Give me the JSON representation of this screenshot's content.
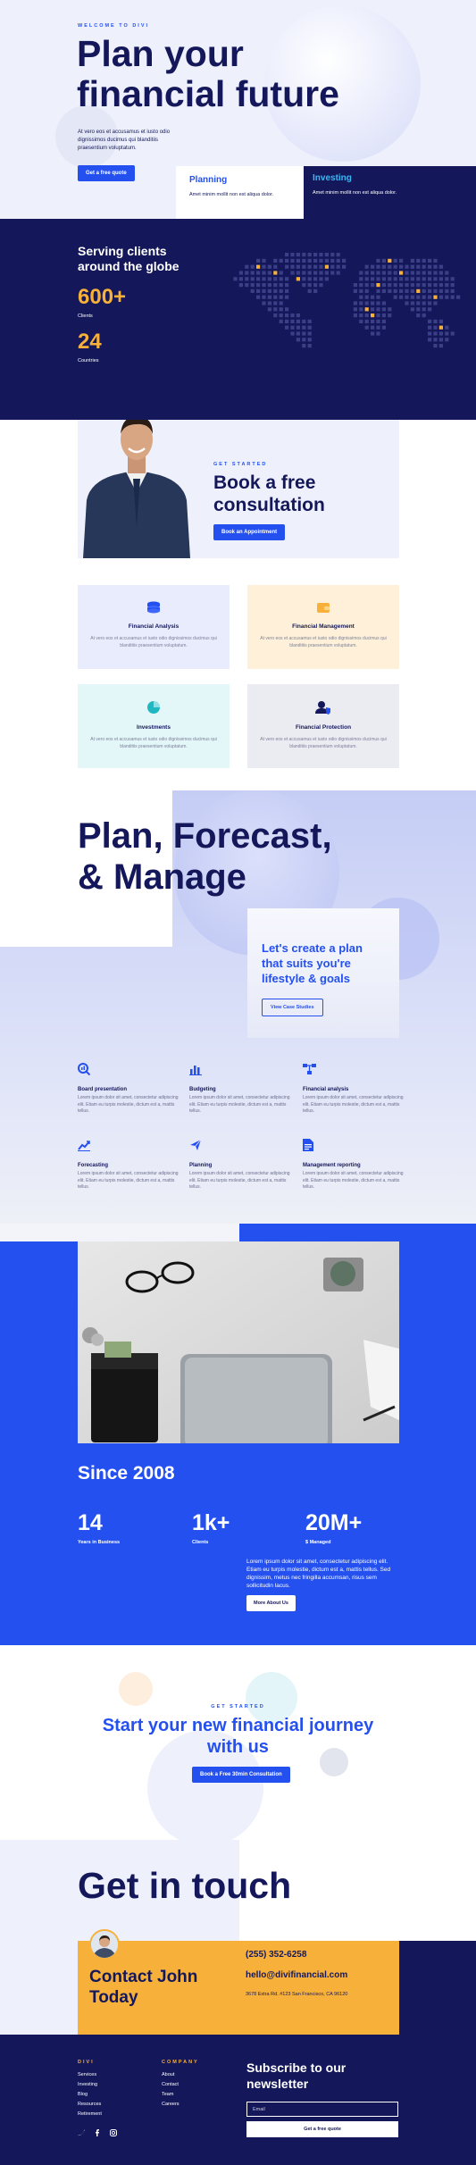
{
  "hero": {
    "eyebrow": "WELCOME TO DIVI",
    "title_line1": "Plan your",
    "title_line2": "financial future",
    "description": "At vero eos et accusamus et iusto odio dignissimos ducimus qui blanditiis praesentium voluptatum.",
    "cta_label": "Get a free quote",
    "cards": [
      {
        "title": "Planning",
        "text": "Amet minim mollit non est aliqua dolor."
      },
      {
        "title": "Investing",
        "text": "Amet minim mollit non est aliqua dolor."
      }
    ]
  },
  "world": {
    "heading_line1": "Serving clients",
    "heading_line2": "around the globe",
    "stats": [
      {
        "value": "600+",
        "label": "Clients"
      },
      {
        "value": "24",
        "label": "Countries"
      }
    ]
  },
  "consult": {
    "eyebrow": "GET STARTED",
    "title_line1": "Book a free",
    "title_line2": "consultation",
    "cta_label": "Book an Appointment"
  },
  "services": [
    {
      "title": "Financial Analysis",
      "text": "At vero eos et accusamus et iusto odio dignissimos ducimus qui blanditiis praesentium voluptatum.",
      "icon": "coins-stack-icon",
      "bg": "#e8ecfd",
      "color": "#2450f0"
    },
    {
      "title": "Financial Management",
      "text": "At vero eos et accusamus et iusto odio dignissimos ducimus qui blanditiis praesentium voluptatum.",
      "icon": "wallet-icon",
      "bg": "#fff1d9",
      "color": "#f7b13b"
    },
    {
      "title": "Investments",
      "text": "At vero eos et accusamus et iusto odio dignissimos ducimus qui blanditiis praesentium voluptatum.",
      "icon": "pie-chart-icon",
      "bg": "#e3f7f8",
      "color": "#1fb7c1"
    },
    {
      "title": "Financial Protection",
      "text": "At vero eos et accusamus et iusto odio dignissimos ducimus qui blanditiis praesentium voluptatum.",
      "icon": "user-shield-icon",
      "bg": "#ebebf2",
      "color": "#14185a"
    }
  ],
  "plan": {
    "title_line1": "Plan, Forecast,",
    "title_line2": "& Manage",
    "card_title": "Let's create a plan that suits you're lifestyle & goals",
    "card_cta": "View Case Studies",
    "features": [
      {
        "title": "Board presentation",
        "text": "Lorem ipsum dolor sit amet, consectetur adipiscing elit. Etiam eu turpis molestie, dictum est a, mattis tellus.",
        "icon": "search-chart-icon"
      },
      {
        "title": "Budgeting",
        "text": "Lorem ipsum dolor sit amet, consectetur adipiscing elit. Etiam eu turpis molestie, dictum est a, mattis tellus.",
        "icon": "bar-chart-icon"
      },
      {
        "title": "Financial analysis",
        "text": "Lorem ipsum dolor sit amet, consectetur adipiscing elit. Etiam eu turpis molestie, dictum est a, mattis tellus.",
        "icon": "flowchart-icon"
      },
      {
        "title": "Forecasting",
        "text": "Lorem ipsum dolor sit amet, consectetur adipiscing elit. Etiam eu turpis molestie, dictum est a, mattis tellus.",
        "icon": "trend-line-icon"
      },
      {
        "title": "Planning",
        "text": "Lorem ipsum dolor sit amet, consectetur adipiscing elit. Etiam eu turpis molestie, dictum est a, mattis tellus.",
        "icon": "paper-plane-icon"
      },
      {
        "title": "Management reporting",
        "text": "Lorem ipsum dolor sit amet, consectetur adipiscing elit. Etiam eu turpis molestie, dictum est a, mattis tellus.",
        "icon": "document-icon"
      }
    ]
  },
  "since": {
    "heading": "Since 2008",
    "stats": [
      {
        "value": "14",
        "label": "Years in Business"
      },
      {
        "value": "1k+",
        "label": "Clients"
      },
      {
        "value": "20M+",
        "label": "$ Managed"
      }
    ],
    "description": "Lorem ipsum dolor sit amet, consectetur adipiscing elit. Etiam eu turpis molestie, dictum est a, mattis tellus. Sed dignissim, metus nec fringilla accumsan, risus sem sollicitudin lacus.",
    "cta_label": "More About Us"
  },
  "journey": {
    "eyebrow": "GET STARTED",
    "title_line1": "Start your new financial journey",
    "title_line2": "with us",
    "cta_label": "Book a Free 30min Consultation"
  },
  "contact": {
    "heading": "Get in touch",
    "name_line1": "Contact John",
    "name_line2": "Today",
    "phone": "(255) 352-6258",
    "email": "hello@divifinancial.com",
    "address": "3678 Extra Rd. #123 San Francisco, CA 96120"
  },
  "footer": {
    "col1_title": "DIVI",
    "col1_links": [
      "Services",
      "Investing",
      "Blog",
      "Resources",
      "Retirement"
    ],
    "col2_title": "COMPANY",
    "col2_links": [
      "About",
      "Contact",
      "Team",
      "Careers"
    ],
    "newsletter_line1": "Subscribe to our",
    "newsletter_line2": "newsletter",
    "email_placeholder": "Email",
    "subscribe_label": "Get a free quote",
    "social": [
      "twitter-icon",
      "facebook-icon",
      "instagram-icon"
    ]
  },
  "colors": {
    "navy": "#14185a",
    "blue": "#2450f0",
    "orange": "#f7b13b",
    "light": "#eef1fb"
  }
}
